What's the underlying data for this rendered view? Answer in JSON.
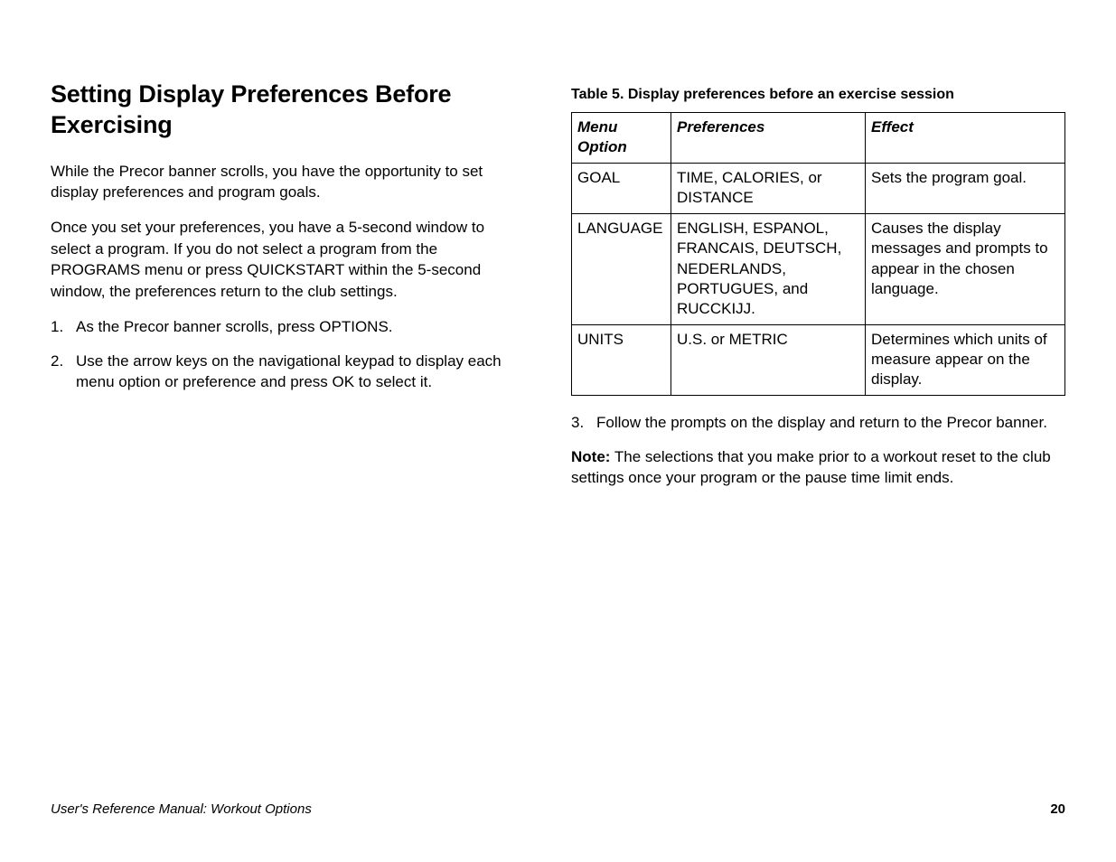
{
  "left": {
    "heading": "Setting Display Preferences Before Exercising",
    "para1": "While the Precor banner scrolls, you have the opportunity to set display preferences and program goals.",
    "para2": "Once you set your preferences, you have a 5-second window to select a program. If you do not select a program from the PROGRAMS menu or press QUICKSTART within the 5-second window, the preferences return to the club settings.",
    "step1": "As the Precor banner scrolls, press OPTIONS.",
    "step2": "Use the arrow keys on the navigational keypad to display each menu option or preference and press OK to select it."
  },
  "right": {
    "tableCaption": "Table 5. Display preferences before an exercise session",
    "headers": {
      "menu": "Menu Option",
      "pref": "Preferences",
      "effect": "Effect"
    },
    "rows": [
      {
        "menu": "GOAL",
        "pref": "TIME, CALORIES, or DISTANCE",
        "effect": "Sets the program goal."
      },
      {
        "menu": "LANGUAGE",
        "pref": "ENGLISH, ESPANOL, FRANCAIS, DEUTSCH, NEDERLANDS, PORTUGUES, and RUCCKIJJ.",
        "effect": "Causes the display messages and prompts to appear in the chosen language."
      },
      {
        "menu": "UNITS",
        "pref": "U.S. or METRIC",
        "effect": "Determines which units of measure appear on the display."
      }
    ],
    "step3": "Follow the prompts on the display and return to the Precor banner.",
    "noteLabel": "Note:",
    "noteText": " The selections that you make prior to a workout reset to the club settings once your program or the pause time limit ends."
  },
  "footer": {
    "title": "User's Reference Manual: Workout Options",
    "page": "20"
  }
}
